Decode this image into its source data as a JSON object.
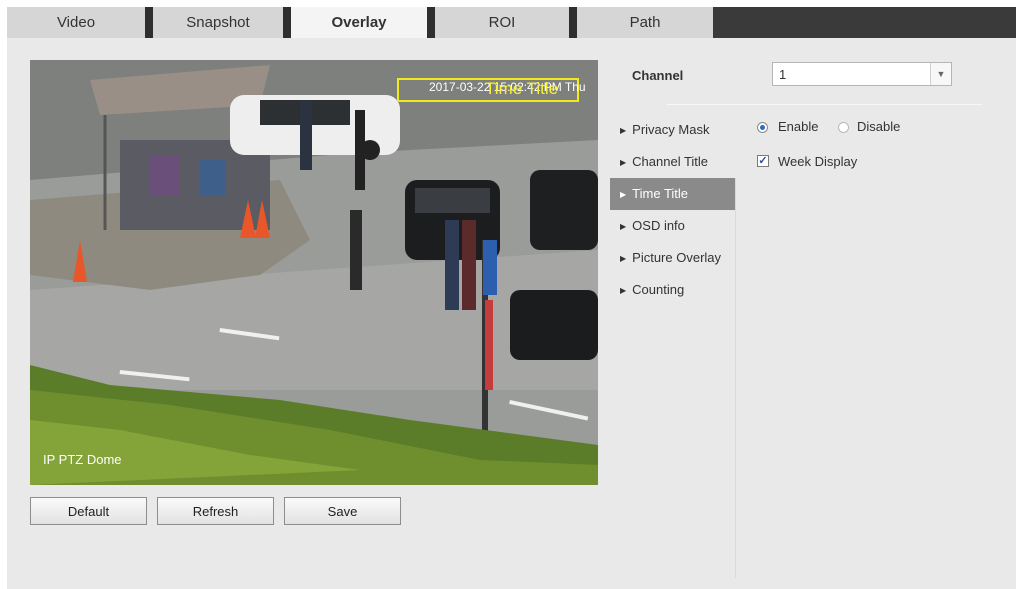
{
  "tabs": [
    {
      "label": "Video"
    },
    {
      "label": "Snapshot"
    },
    {
      "label": "Overlay"
    },
    {
      "label": "ROI"
    },
    {
      "label": "Path"
    }
  ],
  "preview": {
    "time_overlay": "2017-03-22 15:02:42 PM Thu",
    "time_title": "Time Title",
    "channel_overlay": "IP PTZ Dome"
  },
  "buttons": {
    "default": "Default",
    "refresh": "Refresh",
    "save": "Save"
  },
  "channel": {
    "label": "Channel",
    "value": "1"
  },
  "menu": [
    {
      "label": "Privacy Mask"
    },
    {
      "label": "Channel Title"
    },
    {
      "label": "Time Title"
    },
    {
      "label": "OSD info"
    },
    {
      "label": "Picture Overlay"
    },
    {
      "label": "Counting"
    }
  ],
  "time_title_settings": {
    "enable_label": "Enable",
    "disable_label": "Disable",
    "week_display_label": "Week Display"
  },
  "colors": {
    "tab_active_bg": "#f4f4f4",
    "menu_active_bg": "#8a8a8a",
    "osd_yellow": "#f2ea1f"
  }
}
